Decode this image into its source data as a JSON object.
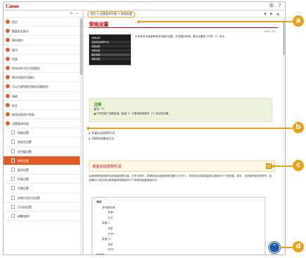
{
  "app": {
    "logo": "Canon",
    "top_icons": [
      "gear-icon",
      "help-icon"
    ]
  },
  "sidebar": {
    "expand_label": "+",
    "collapse_label": "−",
    "items": [
      {
        "label": "首页",
        "level": 0,
        "icon": "home"
      },
      {
        "label": "重要安全指示",
        "level": 0,
        "icon": "expand"
      },
      {
        "label": "基本操作",
        "level": 0,
        "icon": "expand"
      },
      {
        "label": "复印",
        "level": 0,
        "icon": "expand"
      },
      {
        "label": "传真",
        "level": 0,
        "icon": "expand"
      },
      {
        "label": "将本机作为打印机使用",
        "level": 0,
        "icon": "expand"
      },
      {
        "label": "将本机用作扫描仪",
        "level": 0,
        "icon": "expand"
      },
      {
        "label": "可以方便地配合移动设备使用",
        "level": 0,
        "icon": "expand"
      },
      {
        "label": "网络",
        "level": 0,
        "icon": "expand"
      },
      {
        "label": "安全",
        "level": 0,
        "icon": "expand"
      },
      {
        "label": "使用远程用户界面",
        "level": 0,
        "icon": "expand"
      },
      {
        "label": "设置菜单列表",
        "level": 0,
        "icon": "expand"
      },
      {
        "label": "网络设置",
        "level": 1,
        "icon": "page"
      },
      {
        "label": "首选项设置",
        "level": 1,
        "icon": "page"
      },
      {
        "label": "定时器设置",
        "level": 1,
        "icon": "page"
      },
      {
        "label": "常规设置",
        "level": 1,
        "icon": "page",
        "active": true
      },
      {
        "label": "复印设置",
        "level": 1,
        "icon": "page"
      },
      {
        "label": "传真设置",
        "level": 1,
        "icon": "page"
      },
      {
        "label": "扫描设置",
        "level": 1,
        "icon": "page"
      },
      {
        "label": "存储介质打印设置",
        "level": 1,
        "icon": "page"
      },
      {
        "label": "打印机设置",
        "level": 1,
        "icon": "page"
      },
      {
        "label": "调整/维护",
        "level": 1,
        "icon": "page"
      }
    ]
  },
  "content": {
    "breadcrumb": "首页 > 设置菜单列表 > 常规设置",
    "nav_icons": "◀ ▶ ▲",
    "page_title": "常规设置",
    "doc_id": "18WS-0JE",
    "description": "列出有关手纸盒等相关功能的设置，并有图形说明。默认设置用十字符（*）标示。",
    "screen": {
      "title": "常规设置",
      "items": [
        "纸盒自动选择开/关",
        "纸盒设置",
        "纸张设置",
        "默认设置",
        "重复设置"
      ]
    },
    "note": {
      "title": "注释",
      "subtitle": "星号（*）",
      "text": "只有安装了选配纸盒（纸盒 2）才能使用带星号（*）标记的设置。"
    },
    "toc": [
      "纸盒自动选择开/关",
      "切换纸张输送方法"
    ],
    "section": {
      "title": "纸盒自动选择开/关"
    },
    "body_text": "启用或禁用纸盒的自动纸盒选择功能。打印文档时，如果将自动纸盒选择设置为<打开>，本机将自动选择装有合适纸张尺寸的纸源。另外，当选用的纸张用尽时，此设置可以将自动切换到装有相同纸张尺寸的其他纸盒继续打印。",
    "menu_lines": [
      {
        "text": "复印",
        "indent": 0
      },
      {
        "text": "多功能托盘",
        "indent": 2
      },
      {
        "text": "关闭*",
        "indent": 4
      },
      {
        "text": "打开",
        "indent": 4
      },
      {
        "text": "纸盒 1",
        "indent": 2
      },
      {
        "text": "关闭",
        "indent": 4
      },
      {
        "text": "打开*",
        "indent": 4
      },
      {
        "text": "纸盒 2*",
        "indent": 2
      },
      {
        "text": "关闭",
        "indent": 4
      },
      {
        "text": "打开*",
        "indent": 4
      },
      {
        "text": "打印机",
        "indent": 0
      },
      {
        "text": "纸盒 1",
        "indent": 2
      }
    ],
    "to_top_label": "⌃"
  },
  "callouts": [
    "a",
    "b",
    "c",
    "d"
  ],
  "colors": {
    "brand": "#cc0000",
    "accent": "#e05a26",
    "callout": "#e8a21c",
    "note_bg": "#eaf3dc",
    "to_top": "#1f5da8"
  }
}
